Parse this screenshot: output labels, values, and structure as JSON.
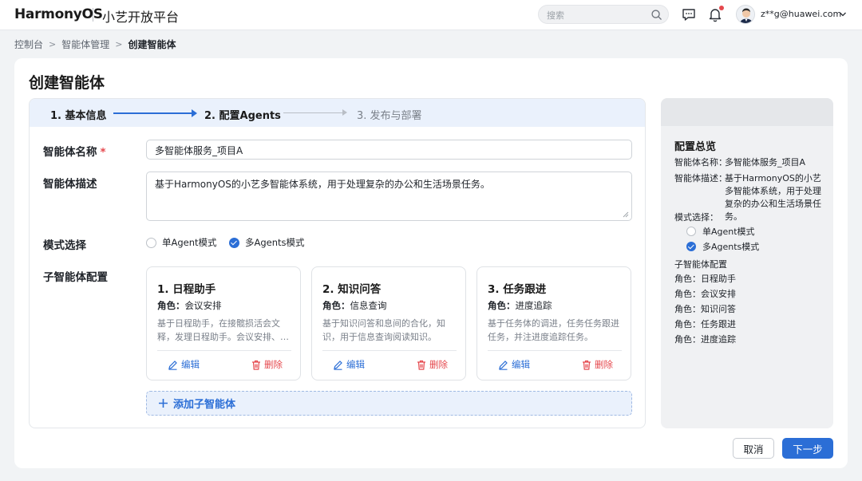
{
  "header": {
    "brand": "HarmonyOS",
    "platform": "小艺开放平台",
    "search_placeholder": "搜索",
    "user_email": "z**g@huawei.com",
    "icons": [
      "search-icon",
      "message-icon",
      "bell-icon",
      "avatar",
      "chevron-down-icon"
    ],
    "notification_dot_color": "#e5484d"
  },
  "breadcrumb": [
    "控制台",
    "智能体管理",
    "创建智能体"
  ],
  "page": {
    "title": "创建智能体",
    "steps": [
      {
        "label": "1. 基本信息",
        "state": "done"
      },
      {
        "label": "2. 配置Agents",
        "state": "current"
      },
      {
        "label": "3. 发布与部署",
        "state": "pending"
      }
    ]
  },
  "form": {
    "name_label": "智能体名称",
    "name_required_mark": "*",
    "name_value": "多智能体服务_项目A",
    "desc_label": "智能体描述",
    "desc_value": "基于HarmonyOS的小艺多智能体系统，用于处理复杂的办公和生活场景任务。",
    "mode_label": "模式选择",
    "mode_options": [
      {
        "label": "单Agent模式",
        "selected": false
      },
      {
        "label": "多Agents模式",
        "selected": true
      }
    ],
    "sub_agents_label": "子智能体配置",
    "agents": [
      {
        "title": "1. 日程助手",
        "role_label": "角色：",
        "role": "会议安排",
        "desc": "基于日程助手，在接髋损活会文释，发理日程助手。会议安排、…",
        "edit": "编辑",
        "delete": "删除"
      },
      {
        "title": "2. 知识问答",
        "role_label": "角色：",
        "role": "信息查询",
        "desc": "基于知识问答和息间的合化，知识，用于信息查询阅读知识。",
        "edit": "编辑",
        "delete": "删除"
      },
      {
        "title": "3. 任务跟进",
        "role_label": "角色：",
        "role": "进度追踪",
        "desc": "基于任务体的调进，任务任务跟进任务，并注进度追踪任务。",
        "edit": "编辑",
        "delete": "删除"
      }
    ],
    "add_button": "添加子智能体"
  },
  "summary": {
    "title": "配置总览",
    "name_key": "智能体名称：",
    "name_val": "多智能体服务_项目A",
    "desc_key": "智能体描述：",
    "desc_val": "基于HarmonyOS的小艺多智能体系统，用于处理复杂的办公和生活场景任务。",
    "mode_key": "模式选择：",
    "mode_options": [
      {
        "label": "单Agent模式",
        "selected": false
      },
      {
        "label": "多Agents模式",
        "selected": true
      }
    ],
    "sub_title": "子智能体配置",
    "roles": [
      "角色：日程助手",
      "角色：会议安排",
      "角色：知识问答",
      "角色：任务跟进",
      "角色：进度追踪"
    ]
  },
  "footer": {
    "cancel": "取消",
    "next": "下一步"
  },
  "colors": {
    "accent": "#2b6ed6",
    "danger": "#e5484d",
    "step_bar": "#eaf1fc"
  }
}
